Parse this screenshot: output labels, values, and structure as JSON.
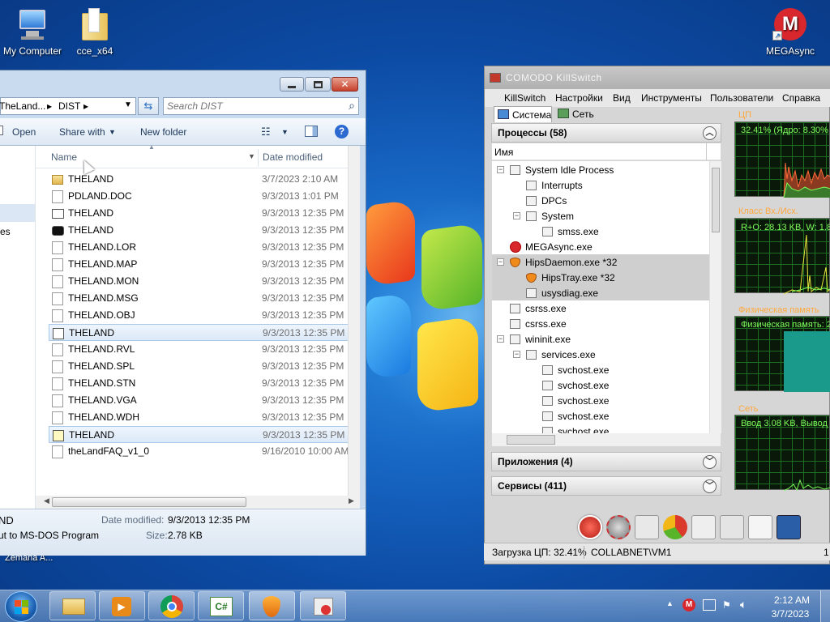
{
  "desktop": {
    "icons": [
      {
        "label": "My Computer",
        "icon": "computer-icon"
      },
      {
        "label": "cce_x64",
        "icon": "folder-icon"
      },
      {
        "label": "MEGAsync",
        "icon": "mega-icon"
      }
    ],
    "partial_label": "Zemana A..."
  },
  "explorer": {
    "breadcrumb": [
      "TheLand...",
      "DIST"
    ],
    "search_placeholder": "Search DIST",
    "toolbar": {
      "open": "Open",
      "share_with": "Share with",
      "new_folder": "New folder"
    },
    "columns": {
      "name": "Name",
      "date": "Date modified"
    },
    "nav_partial": "es",
    "files": [
      {
        "name": "THELAND",
        "date": "3/7/2023 2:10 AM",
        "icon": "folder-icon"
      },
      {
        "name": "PDLAND.DOC",
        "date": "9/3/2013 1:01 PM",
        "icon": "file-icon"
      },
      {
        "name": "THELAND",
        "date": "9/3/2013 12:35 PM",
        "icon": "app-icon"
      },
      {
        "name": "THELAND",
        "date": "9/3/2013 12:35 PM",
        "icon": "dos-icon"
      },
      {
        "name": "THELAND.LOR",
        "date": "9/3/2013 12:35 PM",
        "icon": "file-icon"
      },
      {
        "name": "THELAND.MAP",
        "date": "9/3/2013 12:35 PM",
        "icon": "file-icon"
      },
      {
        "name": "THELAND.MON",
        "date": "9/3/2013 12:35 PM",
        "icon": "file-icon"
      },
      {
        "name": "THELAND.MSG",
        "date": "9/3/2013 12:35 PM",
        "icon": "file-icon"
      },
      {
        "name": "THELAND.OBJ",
        "date": "9/3/2013 12:35 PM",
        "icon": "file-icon"
      },
      {
        "name": "THELAND",
        "date": "9/3/2013 12:35 PM",
        "icon": "shortcut-icon"
      },
      {
        "name": "THELAND.RVL",
        "date": "9/3/2013 12:35 PM",
        "icon": "file-icon"
      },
      {
        "name": "THELAND.SPL",
        "date": "9/3/2013 12:35 PM",
        "icon": "file-icon"
      },
      {
        "name": "THELAND.STN",
        "date": "9/3/2013 12:35 PM",
        "icon": "file-icon"
      },
      {
        "name": "THELAND.VGA",
        "date": "9/3/2013 12:35 PM",
        "icon": "file-icon"
      },
      {
        "name": "THELAND.WDH",
        "date": "9/3/2013 12:35 PM",
        "icon": "file-icon"
      },
      {
        "name": "THELAND",
        "date": "9/3/2013 12:35 PM",
        "icon": "pif-icon"
      },
      {
        "name": "theLandFAQ_v1_0",
        "date": "9/16/2010 10:00 AM",
        "icon": "file-icon"
      }
    ],
    "details": {
      "name": "ND",
      "type": "ut to MS-DOS Program",
      "date_label": "Date modified:",
      "date_value": "9/3/2013 12:35 PM",
      "size_label": "Size:",
      "size_value": "2.78 KB"
    }
  },
  "killswitch": {
    "title": "COMODO KillSwitch",
    "menu": [
      "KillSwitch",
      "Настройки",
      "Вид",
      "Инструменты",
      "Пользователи",
      "Справка"
    ],
    "tabs": [
      "Система",
      "Сеть"
    ],
    "processes_header": "Процессы (58)",
    "column_name": "Имя",
    "processes": [
      {
        "name": "System Idle Process",
        "level": 0,
        "icon": "window-icon"
      },
      {
        "name": "Interrupts",
        "level": 1,
        "icon": "window-icon"
      },
      {
        "name": "DPCs",
        "level": 1,
        "icon": "window-icon"
      },
      {
        "name": "System",
        "level": 1,
        "icon": "window-icon"
      },
      {
        "name": "smss.exe",
        "level": 2,
        "icon": "window-icon"
      },
      {
        "name": "MEGAsync.exe",
        "level": 0,
        "icon": "mega-icon"
      },
      {
        "name": "HipsDaemon.exe *32",
        "level": 0,
        "icon": "comodo-shield-icon"
      },
      {
        "name": "HipsTray.exe *32",
        "level": 1,
        "icon": "comodo-shield-icon"
      },
      {
        "name": "usysdiag.exe",
        "level": 1,
        "icon": "window-icon"
      },
      {
        "name": "csrss.exe",
        "level": 0,
        "icon": "window-icon"
      },
      {
        "name": "csrss.exe",
        "level": 0,
        "icon": "window-icon"
      },
      {
        "name": "wininit.exe",
        "level": 0,
        "icon": "window-icon"
      },
      {
        "name": "services.exe",
        "level": 1,
        "icon": "window-icon"
      },
      {
        "name": "svchost.exe",
        "level": 2,
        "icon": "window-icon"
      },
      {
        "name": "svchost.exe",
        "level": 2,
        "icon": "window-icon"
      },
      {
        "name": "svchost.exe",
        "level": 2,
        "icon": "window-icon"
      },
      {
        "name": "svchost.exe",
        "level": 2,
        "icon": "window-icon"
      },
      {
        "name": "svchost.exe",
        "level": 2,
        "icon": "window-icon"
      }
    ],
    "apps_header": "Приложения (4)",
    "services_header": "Сервисы (411)",
    "graphs": [
      {
        "label": "ЦП",
        "reading": "32.41% (Ядро: 8.30%"
      },
      {
        "label": "Класс Вх./Исх.",
        "reading": "R+O: 28.13 KB, W: 1.8"
      },
      {
        "label": "Физическая память",
        "reading": "Физическая память: 2"
      },
      {
        "label": "Сеть",
        "reading": "Ввод 3.08 KB, Вывод"
      }
    ],
    "status": {
      "cpu": "Загрузка ЦП: 32.41%",
      "user": "COLLABNET\\VM1",
      "partial": "1"
    }
  },
  "taskbar": {
    "apps": [
      "explorer-icon",
      "media-player-icon",
      "chrome-icon",
      "csharp-icon",
      "comodo-shield-icon",
      "killswitch-icon"
    ],
    "clock_time": "2:12 AM",
    "clock_date": "3/7/2023"
  },
  "colors": {
    "graph_green": "#7dfc5a",
    "graph_label": "#ffa83c",
    "highlight": "#cfcfcf"
  }
}
